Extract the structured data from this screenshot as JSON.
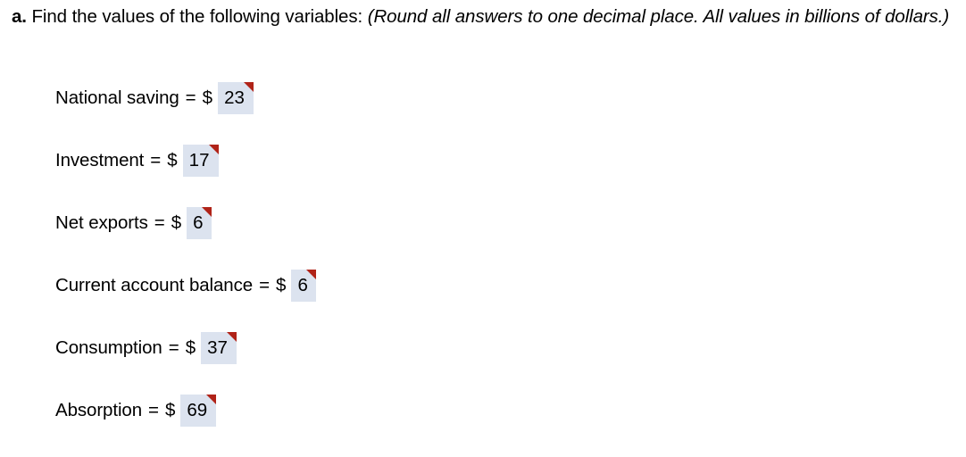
{
  "prompt": {
    "letter": "a.",
    "text": " Find the values of the following variables: ",
    "note": "(Round all answers to one decimal place. All values in billions of dollars.)"
  },
  "symbols": {
    "equals": "=",
    "currency": "$",
    "flag_icon": "red-corner-flag-icon"
  },
  "colors": {
    "field_background": "#dce3ef",
    "flag_red": "#b02318",
    "text": "#000000",
    "page_background": "#ffffff"
  },
  "answers": [
    {
      "label": "National saving",
      "value": "23",
      "placeholder": "",
      "width": "wide"
    },
    {
      "label": "Investment",
      "value": "17",
      "placeholder": "",
      "width": "wide"
    },
    {
      "label": "Net exports",
      "value": "6",
      "placeholder": "",
      "width": "narrow"
    },
    {
      "label": "Current account balance",
      "value": "6",
      "placeholder": "",
      "width": "narrow"
    },
    {
      "label": "Consumption",
      "value": "37",
      "placeholder": "",
      "width": "wide"
    },
    {
      "label": "Absorption",
      "value": "69",
      "placeholder": "",
      "width": "wide"
    }
  ]
}
